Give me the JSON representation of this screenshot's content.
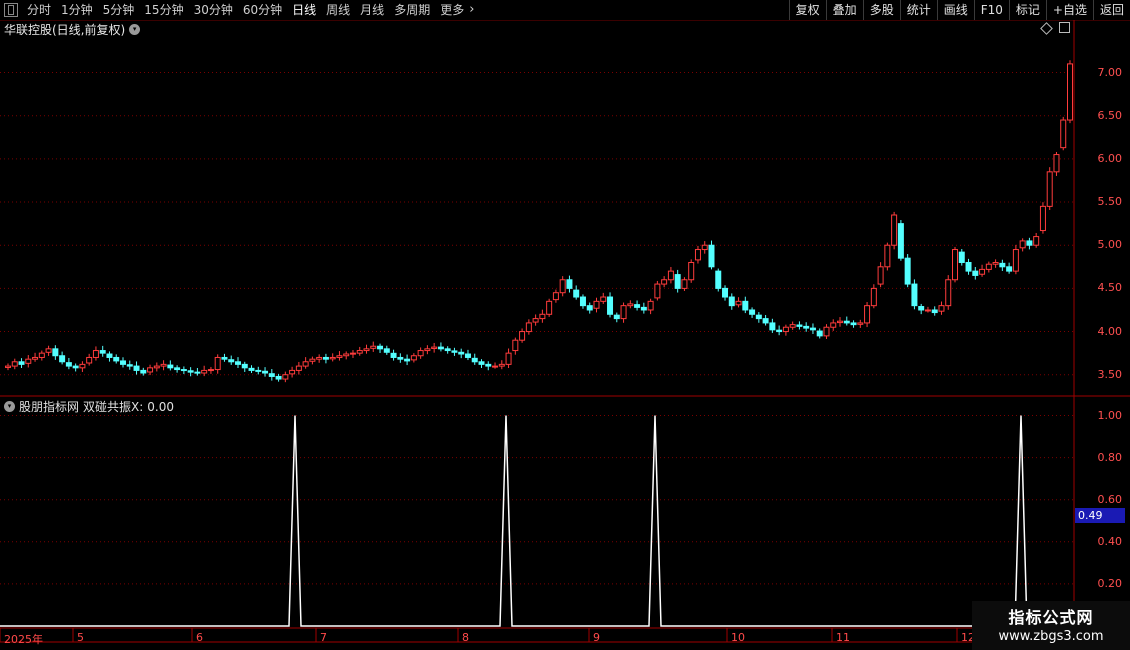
{
  "toolbar": {
    "periods": [
      "分时",
      "1分钟",
      "5分钟",
      "15分钟",
      "30分钟",
      "60分钟",
      "日线",
      "周线",
      "月线",
      "多周期",
      "更多"
    ],
    "active": "日线",
    "right_buttons": [
      "复权",
      "叠加",
      "多股",
      "统计",
      "画线",
      "F10",
      "标记",
      "+自选",
      "返回"
    ]
  },
  "main_title": "华联控股(日线,前复权)",
  "indicator": {
    "source": "股朋指标网",
    "name": "双碰共振X:",
    "value": "0.00"
  },
  "cursor_value": "0.49",
  "price_axis": [
    "7.00",
    "6.50",
    "6.00",
    "5.50",
    "5.00",
    "4.50",
    "4.00",
    "3.50"
  ],
  "ind_axis": [
    "1.00",
    "0.80",
    "0.60",
    "0.40",
    "0.20"
  ],
  "x_axis": [
    "2025年",
    "5",
    "6",
    "7",
    "8",
    "9",
    "10",
    "11",
    "12"
  ],
  "watermark": {
    "line1": "指标公式网",
    "line2": "www.zbgs3.com"
  },
  "colors": {
    "up": "#ff3c3c",
    "down": "#54ffff",
    "axis": "#ff3c3c",
    "grid": "#7a0000",
    "signal": "#ffffff"
  },
  "chart_data": [
    {
      "type": "candlestick",
      "title": "华联控股(日线,前复权)",
      "ylim": [
        3.3,
        7.4
      ],
      "closes": [
        3.6,
        3.65,
        3.62,
        3.68,
        3.7,
        3.75,
        3.8,
        3.72,
        3.65,
        3.6,
        3.58,
        3.62,
        3.7,
        3.78,
        3.75,
        3.7,
        3.66,
        3.62,
        3.6,
        3.55,
        3.52,
        3.58,
        3.6,
        3.62,
        3.58,
        3.56,
        3.55,
        3.53,
        3.52,
        3.55,
        3.56,
        3.7,
        3.68,
        3.65,
        3.62,
        3.58,
        3.55,
        3.54,
        3.52,
        3.48,
        3.45,
        3.5,
        3.55,
        3.6,
        3.65,
        3.68,
        3.7,
        3.68,
        3.7,
        3.72,
        3.74,
        3.75,
        3.78,
        3.8,
        3.83,
        3.8,
        3.76,
        3.7,
        3.68,
        3.66,
        3.72,
        3.78,
        3.8,
        3.82,
        3.8,
        3.78,
        3.76,
        3.74,
        3.7,
        3.65,
        3.62,
        3.6,
        3.6,
        3.62,
        3.75,
        3.9,
        4.0,
        4.1,
        4.15,
        4.2,
        4.35,
        4.45,
        4.6,
        4.5,
        4.4,
        4.3,
        4.25,
        4.35,
        4.4,
        4.2,
        4.15,
        4.3,
        4.32,
        4.28,
        4.25,
        4.35,
        4.55,
        4.6,
        4.7,
        4.5,
        4.6,
        4.8,
        4.95,
        5.0,
        4.75,
        4.5,
        4.4,
        4.3,
        4.35,
        4.25,
        4.2,
        4.15,
        4.1,
        4.02,
        4.0,
        4.05,
        4.08,
        4.06,
        4.04,
        4.02,
        3.95,
        4.05,
        4.1,
        4.12,
        4.1,
        4.08,
        4.1,
        4.3,
        4.5,
        4.75,
        5.0,
        5.35,
        4.85,
        4.55,
        4.3,
        4.25,
        4.25,
        4.22,
        4.3,
        4.6,
        4.95,
        4.8,
        4.7,
        4.65,
        4.72,
        4.78,
        4.8,
        4.75,
        4.7,
        4.95,
        5.05,
        5.0,
        5.1,
        5.45,
        5.85,
        6.05,
        6.45,
        7.1
      ],
      "x_tick_labels": [
        "2025年",
        "5",
        "6",
        "7",
        "8",
        "9",
        "10",
        "11",
        "12"
      ]
    },
    {
      "type": "line",
      "title": "双碰共振X",
      "ylim": [
        0,
        1.05
      ],
      "spike_positions": [
        295,
        506,
        655,
        1021
      ],
      "values_at_spikes": [
        1.0,
        1.0,
        1.0,
        1.0
      ],
      "baseline": 0
    }
  ]
}
